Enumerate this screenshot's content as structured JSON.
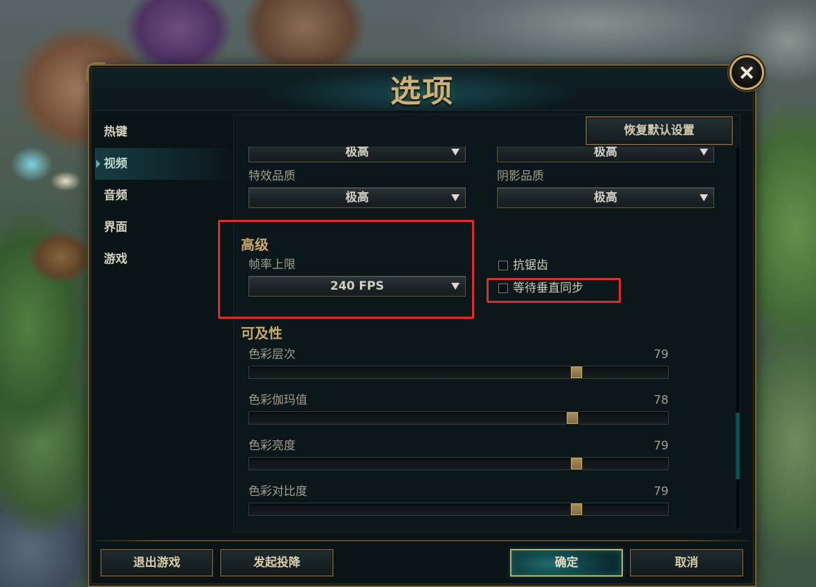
{
  "dialog": {
    "title": "选项"
  },
  "icons": {
    "close": "close-icon",
    "dropdown_arrow": "chevron-down-icon",
    "selected_indicator": "caret-right-icon"
  },
  "sidebar": {
    "items": [
      {
        "label": "热键",
        "selected": false
      },
      {
        "label": "视频",
        "selected": true
      },
      {
        "label": "音频",
        "selected": false
      },
      {
        "label": "界面",
        "selected": false
      },
      {
        "label": "游戏",
        "selected": false
      }
    ]
  },
  "toolbar": {
    "reset_label": "恢复默认设置"
  },
  "video": {
    "top_row": {
      "left_value": "极高",
      "right_value": "极高"
    },
    "effects_quality": {
      "label": "特效品质",
      "value": "极高"
    },
    "shadow_quality": {
      "label": "阴影品质",
      "value": "极高"
    },
    "advanced": {
      "heading": "高级",
      "frame_rate_cap": {
        "label": "帧率上限",
        "value": "240 FPS"
      },
      "anti_aliasing": {
        "label": "抗锯齿",
        "checked": false
      },
      "vsync": {
        "label": "等待垂直同步",
        "checked": false
      }
    },
    "accessibility": {
      "heading": "可及性",
      "sliders": [
        {
          "label": "色彩层次",
          "value": 79
        },
        {
          "label": "色彩伽玛值",
          "value": 78
        },
        {
          "label": "色彩亮度",
          "value": 79
        },
        {
          "label": "色彩对比度",
          "value": 79
        }
      ]
    }
  },
  "footer": {
    "quit_label": "退出游戏",
    "surrender_label": "发起投降",
    "confirm_label": "确定",
    "cancel_label": "取消"
  },
  "colors": {
    "gold": "#c8aa6e",
    "text": "#d6d2c0",
    "label": "#a39e8c",
    "teal": "#0ac8b9",
    "annotation_red": "#e22b2b",
    "panel_bg": "#0a1417"
  }
}
